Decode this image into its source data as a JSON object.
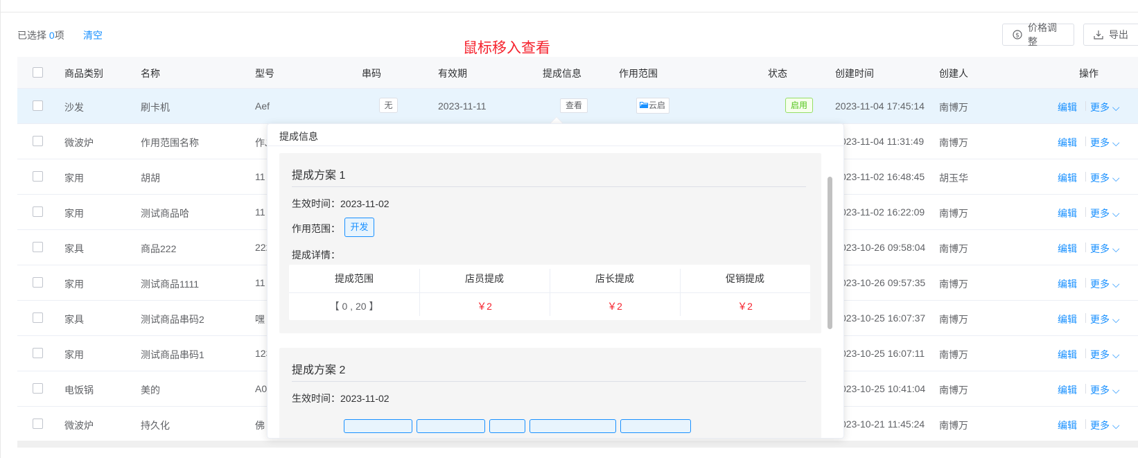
{
  "toolbar": {
    "selected_prefix": "已选择 ",
    "selected_count": "0",
    "selected_suffix": "项",
    "clear_label": "清空",
    "price_adjust_label": "价格调整",
    "export_label": "导出"
  },
  "annotation": "鼠标移入查看",
  "columns": [
    "商品类别",
    "名称",
    "型号",
    "串码",
    "有效期",
    "提成信息",
    "作用范围",
    "状态",
    "创建时间",
    "创建人",
    "操作"
  ],
  "rows": [
    {
      "category": "沙发",
      "name": "刷卡机",
      "model": "Aef",
      "serial": "无",
      "valid": "2023-11-11",
      "commission": "查看",
      "scope": "云启",
      "status": "启用",
      "created": "2023-11-04 17:45:14",
      "creator": "南博万"
    },
    {
      "category": "微波炉",
      "name": "作用范围名称",
      "model": "作J",
      "created": "023-11-04 11:31:49",
      "creator": "南博万"
    },
    {
      "category": "家用",
      "name": "胡胡",
      "model": "11",
      "created": "023-11-02 16:48:45",
      "creator": "胡玉华"
    },
    {
      "category": "家用",
      "name": "测试商品哈",
      "model": "11",
      "created": "023-11-02 16:22:09",
      "creator": "南博万"
    },
    {
      "category": "家具",
      "name": "商品222",
      "model": "222",
      "created": "023-10-26 09:58:04",
      "creator": "南博万"
    },
    {
      "category": "家用",
      "name": "测试商品1111",
      "model": "11",
      "created": "023-10-26 09:57:35",
      "creator": "南博万"
    },
    {
      "category": "家具",
      "name": "测试商品串码2",
      "model": "嘿",
      "created": "023-10-25 16:07:37",
      "creator": "南博万"
    },
    {
      "category": "家用",
      "name": "测试商品串码1",
      "model": "123",
      "created": "023-10-25 16:07:11",
      "creator": "南博万"
    },
    {
      "category": "电饭锅",
      "name": "美的",
      "model": "A0",
      "created": "023-10-25 10:41:04",
      "creator": "南博万"
    },
    {
      "category": "微波炉",
      "name": "持久化",
      "model": "佛",
      "created": "023-10-21 11:45:24",
      "creator": "南博万"
    }
  ],
  "actions": {
    "edit": "编辑",
    "more": "更多"
  },
  "popover": {
    "title": "提成信息",
    "plans": [
      {
        "title": "提成方案 1",
        "effective_label": "生效时间：",
        "effective_date": "2023-11-02",
        "scope_label": "作用范围：",
        "scope_tag": "开发",
        "detail_label": "提成详情：",
        "table_headers": [
          "提成范围",
          "店员提成",
          "店长提成",
          "促销提成"
        ],
        "table_row": [
          "【 0 , 20 】",
          "￥2",
          "￥2",
          "￥2"
        ]
      },
      {
        "title": "提成方案 2",
        "effective_label": "生效时间：",
        "effective_date": "2023-11-02"
      }
    ]
  },
  "colors": {
    "accent": "#1890ff",
    "danger": "#f5222d",
    "success": "#52c41a",
    "highlight_row": "#e8f4fd"
  }
}
